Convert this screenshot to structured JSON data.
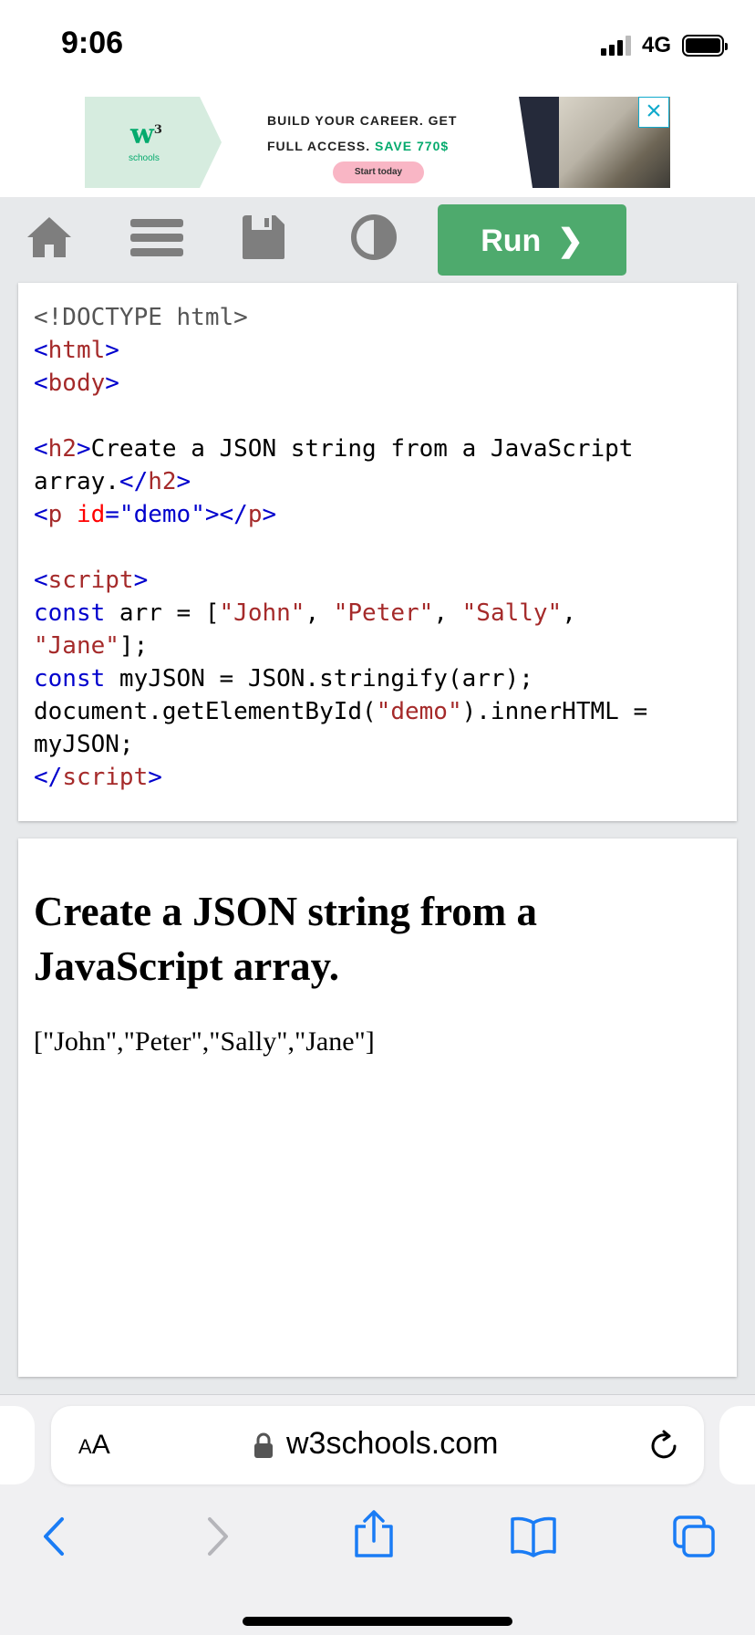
{
  "status_bar": {
    "time": "9:06",
    "network": "4G"
  },
  "ad": {
    "logo_mark": "w",
    "logo_sup": "3",
    "logo_text": "schools",
    "line1": "BUILD YOUR CAREER. GET",
    "line2_prefix": "FULL ACCESS. ",
    "line2_save": "SAVE 770$",
    "cta": "Start today",
    "close_symbol": "×"
  },
  "toolbar": {
    "run_label": "Run",
    "run_chevron": "❯"
  },
  "code": {
    "lines": [
      [
        {
          "t": "<!DOCTYPE html>",
          "c": "c-gray"
        }
      ],
      [
        {
          "t": "<",
          "c": "c-blue"
        },
        {
          "t": "html",
          "c": "c-brown"
        },
        {
          "t": ">",
          "c": "c-blue"
        }
      ],
      [
        {
          "t": "<",
          "c": "c-blue"
        },
        {
          "t": "body",
          "c": "c-brown"
        },
        {
          "t": ">",
          "c": "c-blue"
        }
      ],
      [],
      [
        {
          "t": "<",
          "c": "c-blue"
        },
        {
          "t": "h2",
          "c": "c-brown"
        },
        {
          "t": ">",
          "c": "c-blue"
        },
        {
          "t": "Create a JSON string from a JavaScript",
          "c": ""
        }
      ],
      [
        {
          "t": "array.",
          "c": ""
        },
        {
          "t": "</",
          "c": "c-blue"
        },
        {
          "t": "h2",
          "c": "c-brown"
        },
        {
          "t": ">",
          "c": "c-blue"
        }
      ],
      [
        {
          "t": "<",
          "c": "c-blue"
        },
        {
          "t": "p",
          "c": "c-brown"
        },
        {
          "t": " id",
          "c": "c-red"
        },
        {
          "t": "=\"demo\"",
          "c": "c-blue"
        },
        {
          "t": "></",
          "c": "c-blue"
        },
        {
          "t": "p",
          "c": "c-brown"
        },
        {
          "t": ">",
          "c": "c-blue"
        }
      ],
      [],
      [
        {
          "t": "<",
          "c": "c-blue"
        },
        {
          "t": "script",
          "c": "c-brown"
        },
        {
          "t": ">",
          "c": "c-blue"
        }
      ],
      [
        {
          "t": "const",
          "c": "c-blue"
        },
        {
          "t": " arr = [",
          "c": ""
        },
        {
          "t": "\"John\"",
          "c": "c-str"
        },
        {
          "t": ", ",
          "c": ""
        },
        {
          "t": "\"Peter\"",
          "c": "c-str"
        },
        {
          "t": ", ",
          "c": ""
        },
        {
          "t": "\"Sally\"",
          "c": "c-str"
        },
        {
          "t": ",",
          "c": ""
        }
      ],
      [
        {
          "t": "\"Jane\"",
          "c": "c-str"
        },
        {
          "t": "];",
          "c": ""
        }
      ],
      [
        {
          "t": "const",
          "c": "c-blue"
        },
        {
          "t": " myJSON = JSON.stringify(arr);",
          "c": ""
        }
      ],
      [
        {
          "t": "document.getElementById(",
          "c": ""
        },
        {
          "t": "\"demo\"",
          "c": "c-str"
        },
        {
          "t": ").innerHTML =",
          "c": ""
        }
      ],
      [
        {
          "t": "myJSON;",
          "c": ""
        }
      ],
      [
        {
          "t": "</",
          "c": "c-blue"
        },
        {
          "t": "script",
          "c": "c-brown"
        },
        {
          "t": ">",
          "c": "c-blue"
        }
      ]
    ]
  },
  "result": {
    "heading": "Create a JSON string from a JavaScript array.",
    "output": "[\"John\",\"Peter\",\"Sally\",\"Jane\"]"
  },
  "browser": {
    "aa_small": "A",
    "aa_large": "A",
    "url": "w3schools.com"
  },
  "icons": {
    "home": "home-icon",
    "menu": "menu-icon",
    "save": "save-icon",
    "theme": "contrast-icon",
    "lock": "lock-icon",
    "reload": "reload-icon",
    "back": "back-icon",
    "forward": "forward-icon",
    "share": "share-icon",
    "bookmarks": "bookmarks-icon",
    "tabs": "tabs-icon"
  },
  "colors": {
    "run_green": "#4eaa6d",
    "toolbar_bg": "#e7e9eb",
    "ios_blue": "#1a7cf5"
  }
}
